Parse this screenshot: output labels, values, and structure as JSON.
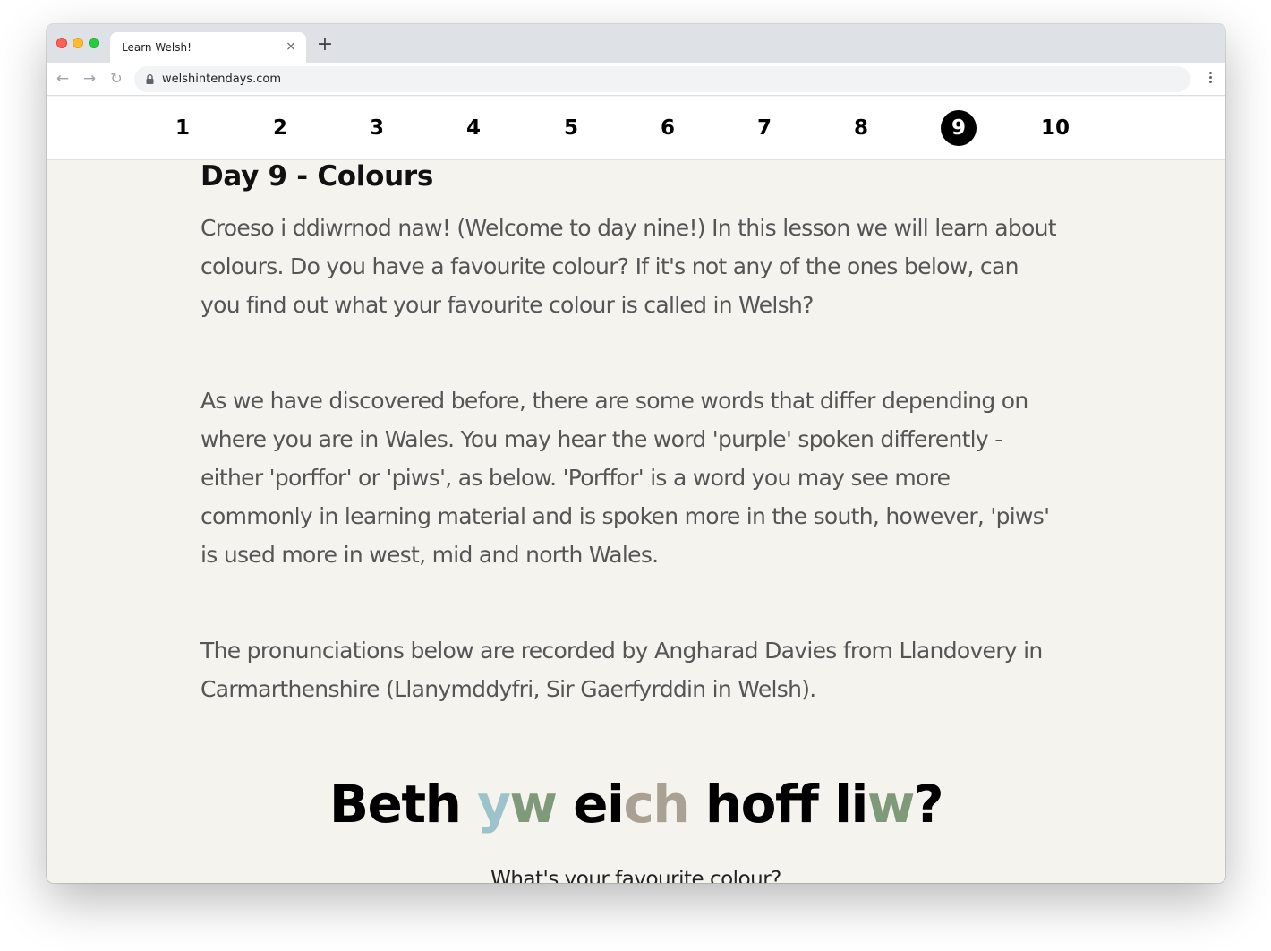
{
  "browser": {
    "tab_title": "Learn Welsh!",
    "tab_close": "×",
    "new_tab": "+",
    "url": "welshintendays.com"
  },
  "day_nav": {
    "items": [
      "1",
      "2",
      "3",
      "4",
      "5",
      "6",
      "7",
      "8",
      "9",
      "10"
    ],
    "active": "9"
  },
  "lesson": {
    "heading": "Day 9 - Colours",
    "paragraphs": [
      "Croeso i ddiwrnod naw! (Welcome to day nine!) In this lesson we will learn about colours. Do you have a favourite colour? If it's not any of the ones below, can you find out what your favourite colour is called in Welsh?",
      "As we have discovered before, there are some words that differ depending on where you are in Wales. You may hear the word 'purple' spoken differently - either 'porffor' or 'piws', as below. 'Porffor' is a word you may see more commonly in learning material and is spoken more in the south, however, 'piws' is used more in west, mid and north Wales.",
      "The pronunciations below are recorded by Angharad Davies from Llandovery in Carmarthenshire (Llanymddyfri, Sir Gaerfyrddin in Welsh)."
    ]
  },
  "feature": {
    "title_parts": {
      "w1": "Beth",
      "w2a": "y",
      "w2b": "w",
      "w3a": "ei",
      "w3b": "ch",
      "w4": "hoff",
      "w5a": "li",
      "w5b": "w",
      "w5c": "?"
    },
    "subtitle": "What's your favourite colour?",
    "colors": {
      "light_blue": "#9cc3cc",
      "sage_green": "#7f9a7a",
      "taupe": "#a8a194"
    }
  }
}
